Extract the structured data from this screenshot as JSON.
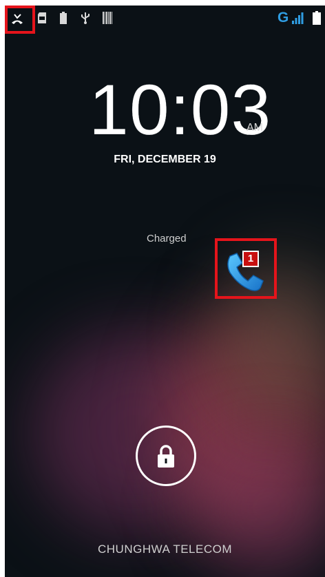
{
  "status_bar": {
    "left_icons": [
      "missed-call-icon",
      "sd-card-icon",
      "battery-small-icon",
      "usb-icon",
      "barcode-icon"
    ],
    "network_type": "G",
    "right_icons": [
      "signal-icon",
      "battery-icon"
    ]
  },
  "lock_screen": {
    "time": "10:03",
    "ampm": "AM",
    "date": "FRI, DECEMBER 19",
    "status_text": "Charged",
    "missed_calls": {
      "icon": "phone-icon",
      "count": "1"
    },
    "lock_icon": "padlock-icon",
    "carrier": "CHUNGHWA TELECOM"
  },
  "colors": {
    "background": "#0b1116",
    "highlight": "#e5141b",
    "network_blue": "#2f9de2",
    "phone_blue": "#2a8fde",
    "badge_red": "#c81010"
  }
}
